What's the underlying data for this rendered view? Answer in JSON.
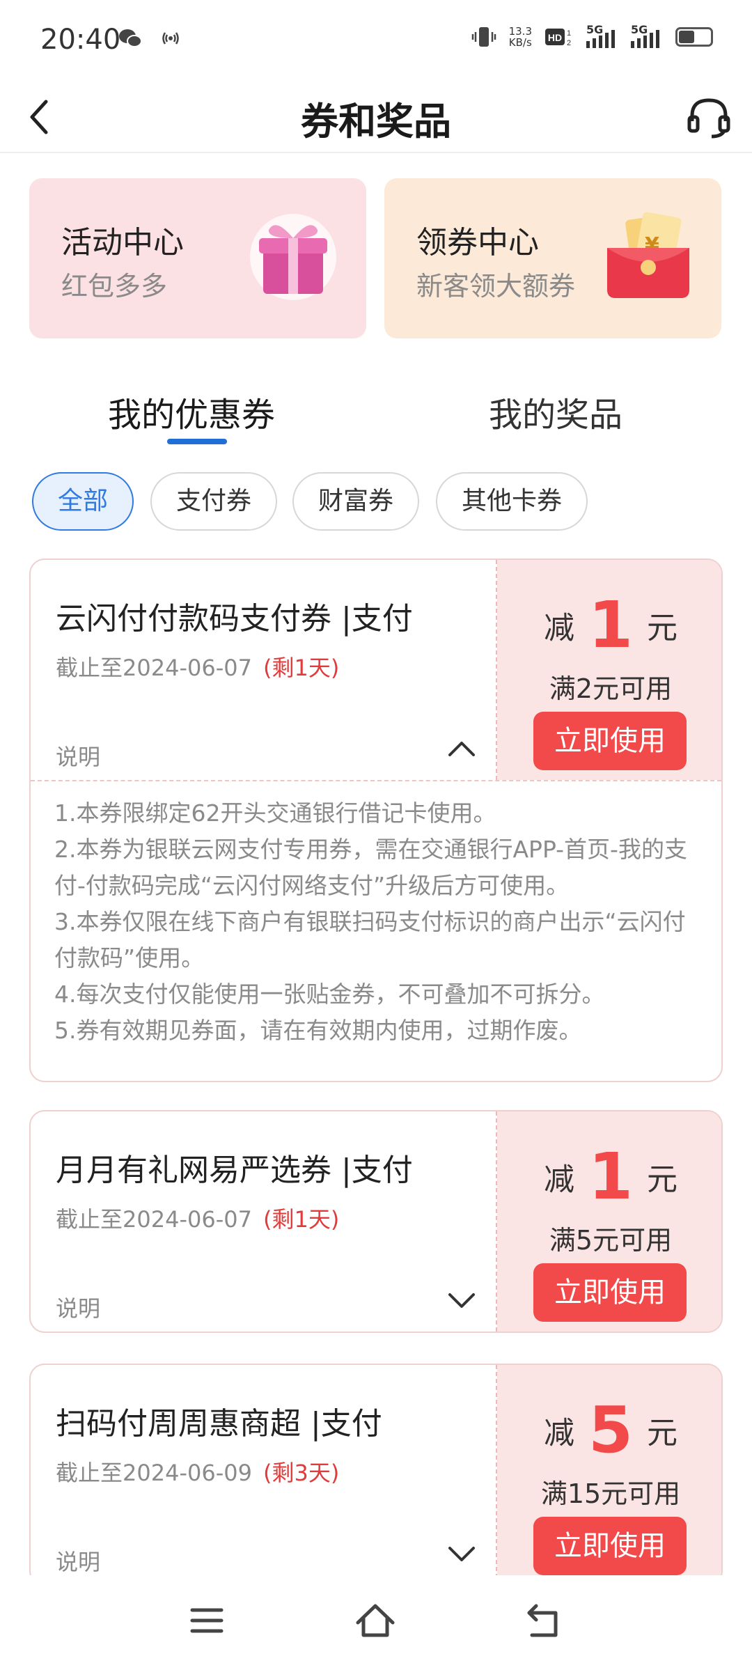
{
  "status_bar": {
    "time": "20:40",
    "net_speed_value": "13.3",
    "net_speed_unit": "KB/s",
    "sim1_label": "5G",
    "sim2_label": "5G",
    "hd_label": "HD"
  },
  "header": {
    "title": "券和奖品"
  },
  "banners": [
    {
      "title": "活动中心",
      "subtitle": "红包多多",
      "icon": "gift-box-icon"
    },
    {
      "title": "领券中心",
      "subtitle": "新客领大额券",
      "icon": "red-envelope-icon"
    }
  ],
  "tabs": [
    {
      "label": "我的优惠券",
      "active": true
    },
    {
      "label": "我的奖品",
      "active": false
    }
  ],
  "filters": [
    {
      "label": "全部",
      "active": true
    },
    {
      "label": "支付券",
      "active": false
    },
    {
      "label": "财富券",
      "active": false
    },
    {
      "label": "其他卡券",
      "active": false
    }
  ],
  "coupons": [
    {
      "name": "云闪付付款码支付券 |支付",
      "deadline": "截止至2024-06-07",
      "remaining": "(剩1天)",
      "explain_label": "说明",
      "expanded": true,
      "prefix": "减",
      "amount": "1",
      "unit": "元",
      "condition": "满2元可用",
      "button": "立即使用",
      "rules": [
        "1.本券限绑定62开头交通银行借记卡使用。",
        "2.本券为银联云网支付专用券，需在交通银行APP-首页-我的支付-付款码完成“云闪付网络支付”升级后方可使用。",
        "3.本券仅限在线下商户有银联扫码支付标识的商户出示“云闪付付款码”使用。",
        "4.每次支付仅能使用一张贴金券，不可叠加不可拆分。",
        "5.券有效期见券面，请在有效期内使用，过期作废。"
      ]
    },
    {
      "name": "月月有礼网易严选券 |支付",
      "deadline": "截止至2024-06-07",
      "remaining": "(剩1天)",
      "explain_label": "说明",
      "expanded": false,
      "prefix": "减",
      "amount": "1",
      "unit": "元",
      "condition": "满5元可用",
      "button": "立即使用"
    },
    {
      "name": "扫码付周周惠商超 |支付",
      "deadline": "截止至2024-06-09",
      "remaining": "(剩3天)",
      "explain_label": "说明",
      "expanded": false,
      "prefix": "减",
      "amount": "5",
      "unit": "元",
      "condition": "满15元可用",
      "button": "立即使用"
    }
  ],
  "colors": {
    "accent_red": "#f24a4a",
    "accent_blue": "#1f6fd6",
    "banner_pink": "#fbe0e4",
    "banner_peach": "#fde9d8"
  }
}
